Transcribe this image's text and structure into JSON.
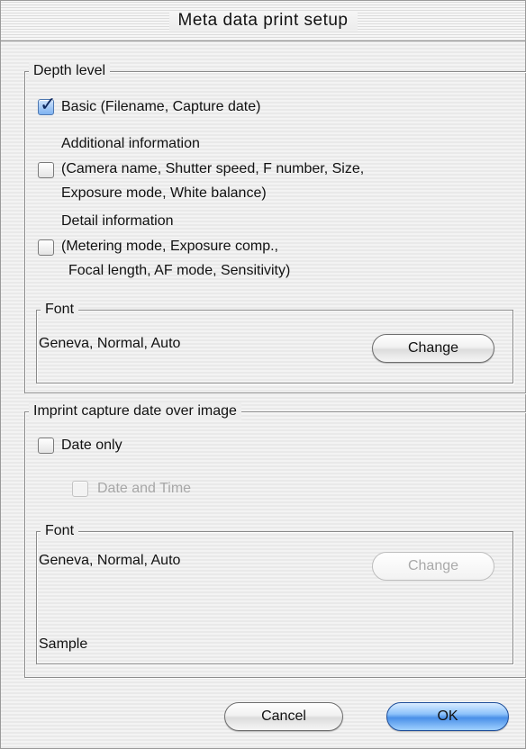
{
  "window": {
    "title": "Meta data print setup"
  },
  "depth_level": {
    "legend": "Depth level",
    "basic": {
      "label": "Basic (Filename, Capture date)",
      "checked": true
    },
    "additional": {
      "heading": "Additional information",
      "line1": "(Camera name, Shutter speed, F number, Size,",
      "line2": "Exposure mode, White balance)",
      "checked": false
    },
    "detail": {
      "heading": "Detail information",
      "line1": "(Metering mode, Exposure comp.,",
      "line2": "Focal length, AF mode, Sensitivity)",
      "checked": false
    },
    "font": {
      "legend": "Font",
      "value": "Geneva, Normal, Auto",
      "change_label": "Change"
    }
  },
  "imprint": {
    "legend": "Imprint capture date over image",
    "date_only": {
      "label": "Date only",
      "checked": false
    },
    "date_and_time": {
      "label": "Date and Time",
      "checked": false,
      "enabled": false
    },
    "font": {
      "legend": "Font",
      "value": "Geneva, Normal, Auto",
      "change_label": "Change",
      "sample": "Sample"
    }
  },
  "footer": {
    "cancel_label": "Cancel",
    "ok_label": "OK"
  }
}
